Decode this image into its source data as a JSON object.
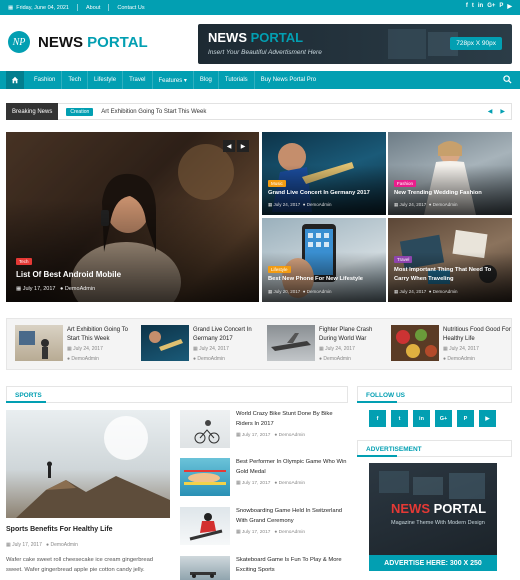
{
  "topbar": {
    "date": "Friday, June 04, 2021",
    "links": [
      "About",
      "Contact Us"
    ],
    "social": [
      "f",
      "t",
      "in",
      "G+",
      "P",
      "▶"
    ]
  },
  "brand": {
    "logo_mark": "NP",
    "name_first": "NEWS",
    "name_second": "PORTAL"
  },
  "header_ad": {
    "title_first": "NEWS",
    "title_second": "PORTAL",
    "subtitle": "Insert Your Beautiful Advertisment Here",
    "size": "728px X 90px"
  },
  "nav": {
    "items": [
      "Fashion",
      "Tech",
      "Lifestyle",
      "Travel",
      "Features ▾",
      "Blog",
      "Tutorials",
      "Buy News Portal Pro"
    ]
  },
  "breaking": {
    "label": "Breaking News",
    "badge": "Creation",
    "headline": "Art Exhibition Going To Start This Week"
  },
  "featured": {
    "main": {
      "category": "Tech",
      "title": "List Of Best Android Mobile",
      "date": "July 17, 2017",
      "author": "DemoAdmin"
    },
    "tiles": [
      {
        "category": "Music",
        "title": "Grand Live Concert In Germany 2017",
        "date": "July 24, 2017",
        "author": "DemoAdmin",
        "cat_color": "#f39c12"
      },
      {
        "category": "Fashion",
        "title": "New Trending Wedding Fashion",
        "date": "July 24, 2017",
        "author": "DemoAdmin",
        "cat_color": "#e91e8c"
      },
      {
        "category": "Lifestyle",
        "title": "Best New Phone For New Lifestyle",
        "date": "July 20, 2017",
        "author": "DemoAdmin",
        "cat_color": "#f39c12"
      },
      {
        "category": "Travel",
        "title": "Most Important Thing That Need To Carry When Traveling",
        "date": "July 24, 2017",
        "author": "DemoAdmin",
        "cat_color": "#8e44ad"
      }
    ]
  },
  "strip": [
    {
      "title": "Art Exhibition Going To Start This Week",
      "date": "July 24, 2017",
      "author": "DemoAdmin"
    },
    {
      "title": "Grand Live Concert In Germany 2017",
      "date": "July 24, 2017",
      "author": "DemoAdmin"
    },
    {
      "title": "Fighter Plane Crash During World War",
      "date": "July 24, 2017",
      "author": "DemoAdmin"
    },
    {
      "title": "Nutritious Food Good For Healthy Life",
      "date": "July 24, 2017",
      "author": "DemoAdmin"
    }
  ],
  "sports": {
    "heading": "SPORTS",
    "main": {
      "title": "Sports Benefits For Healthy Life",
      "date": "July 17, 2017",
      "author": "DemoAdmin",
      "excerpt": "Wafer cake sweet roll cheesecake ice cream gingerbread sweet. Wafer gingerbread apple pie cotton candy jelly."
    },
    "list": [
      {
        "title": "World Crazy Bike Stunt Done By Bike Riders In 2017",
        "date": "July 17, 2017",
        "author": "DemoAdmin"
      },
      {
        "title": "Best Performer In Olympic Game Who Win Gold Medal",
        "date": "July 17, 2017",
        "author": "DemoAdmin"
      },
      {
        "title": "Snowboarding Game Held In Switzerland With Grand Ceremony",
        "date": "July 17, 2017",
        "author": "DemoAdmin"
      },
      {
        "title": "Skateboard Game Is Fun To Play & More Exciting Sports",
        "date": "",
        "author": ""
      }
    ]
  },
  "sidebar": {
    "follow_heading": "FOLLOW US",
    "follow_icons": [
      "f",
      "t",
      "in",
      "G+",
      "P",
      "▶"
    ],
    "ad_heading": "ADVERTISEMENT",
    "ad": {
      "title_first": "NEWS",
      "title_second": "PORTAL",
      "subtitle": "Magazine Theme With Modern Design",
      "cta": "ADVERTISE HERE: 300 X 250"
    }
  },
  "colors": {
    "accent": "#029fb2",
    "dark": "#333333"
  }
}
